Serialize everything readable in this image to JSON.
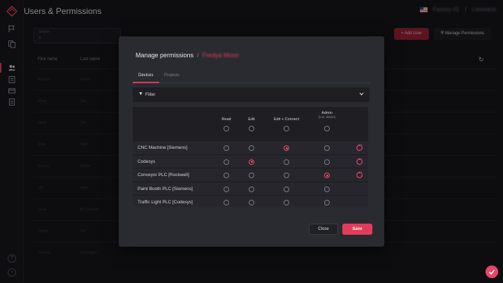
{
  "app": {
    "title": "Users & Permissions"
  },
  "header": {
    "flag_icon": "us-flag-icon",
    "plant": "Factory 01",
    "user": "Louisiana",
    "separator": "/"
  },
  "toolbar": {
    "search_label": "Search",
    "add_user_label": "Add User",
    "manage_permissions_label": "Manage Permissions"
  },
  "table_bg": {
    "columns": [
      "First name",
      "Last name"
    ],
    "rows": [
      [
        "Autumn",
        "Sturm"
      ],
      [
        "Olivia",
        "Inez"
      ],
      [
        "Jason",
        "Chu"
      ],
      [
        "Joset",
        "Walk"
      ],
      [
        "Joanne",
        "Simon"
      ],
      [
        "Lee",
        "Filho"
      ],
      [
        "Lucas",
        "M. Carmela"
      ],
      [
        "Thiago",
        "Uhi"
      ],
      [
        "Theresa",
        "Weldegger"
      ]
    ]
  },
  "modal": {
    "title": "Manage permissions",
    "separator": "/",
    "subject": "Fredya Moss",
    "tabs": [
      {
        "label": "Devices"
      },
      {
        "label": "Projects"
      }
    ],
    "filter_label": "Filter",
    "columns": [
      {
        "label": "Read",
        "note": ""
      },
      {
        "label": "Edit",
        "note": ""
      },
      {
        "label": "Edit + Connect",
        "note": ""
      },
      {
        "label": "Admin",
        "note": "(incl. delete)"
      }
    ],
    "devices": [
      {
        "name": "CNC Machine [Siemens]",
        "selected": "Edit + Connect",
        "resettable": true
      },
      {
        "name": "Codesys",
        "selected": "Edit",
        "resettable": true
      },
      {
        "name": "Conveyor PLC [Rockwell]",
        "selected": "Admin",
        "resettable": true
      },
      {
        "name": "Paint Booth PLC [Siemens]",
        "selected": "",
        "resettable": false
      },
      {
        "name": "Traffic Light PLC [Codesys]",
        "selected": "",
        "resettable": false
      }
    ],
    "close_label": "Close",
    "save_label": "Save"
  },
  "colors": {
    "accent": "#e23c5a",
    "modal_bg": "#2a2a31",
    "page_bg": "#141418"
  }
}
